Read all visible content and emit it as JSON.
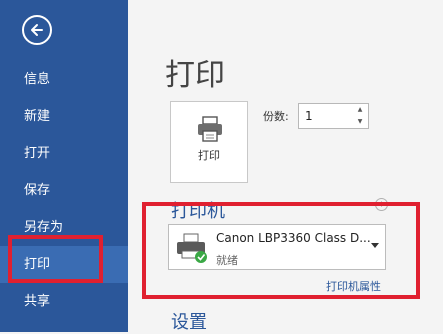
{
  "sidebar": {
    "items": [
      {
        "label": "信息"
      },
      {
        "label": "新建"
      },
      {
        "label": "打开"
      },
      {
        "label": "保存"
      },
      {
        "label": "另存为"
      },
      {
        "label": "打印",
        "active": true
      },
      {
        "label": "共享"
      }
    ]
  },
  "main": {
    "title": "打印",
    "print_button_label": "打印",
    "copies_label": "份数:",
    "copies_value": "1",
    "printer_section_title": "打印机",
    "printer_name": "Canon LBP3360 Class D...",
    "printer_status": "就绪",
    "printer_properties_link": "打印机属性",
    "settings_title": "设置"
  },
  "colors": {
    "sidebar_bg": "#2b579a",
    "sidebar_active": "#3a6cb3",
    "accent": "#2b579a",
    "highlight": "#e02030"
  }
}
